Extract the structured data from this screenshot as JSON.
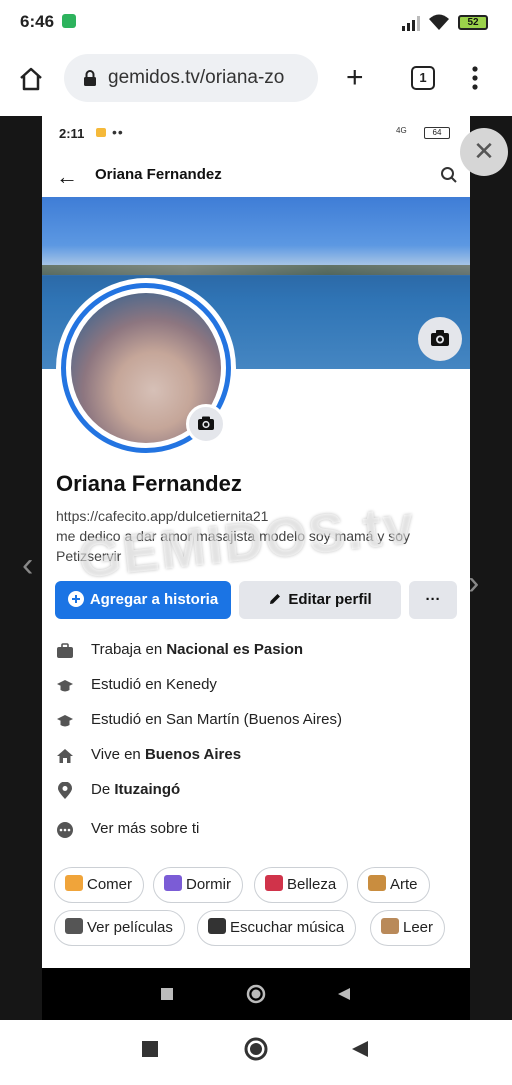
{
  "status_bar": {
    "time": "6:46",
    "battery": "52"
  },
  "browser": {
    "url": "gemidos.tv/oriana-zo",
    "tab_count": "1"
  },
  "viewer": {
    "close_glyph": "✕",
    "prev_glyph": "‹",
    "next_glyph": "›"
  },
  "phone": {
    "status": {
      "time": "2:11",
      "battery": "64",
      "signal": "4G"
    },
    "header": {
      "name": "Oriana Fernandez",
      "back_glyph": "←"
    },
    "profile": {
      "name": "Oriana Fernandez",
      "bio_link": "https://cafecito.app/dulcetiernita21",
      "bio_text": "me dedico a dar amor masajista modelo soy mamá y soy Petizservir",
      "watermark": "GEMIDOS.tv"
    },
    "buttons": {
      "add_story": "Agregar a historia",
      "edit_profile": "Editar perfil",
      "more": "···"
    },
    "details": [
      {
        "prefix": "Trabaja en ",
        "strong": "Nacional es Pasion",
        "icon": "briefcase-icon"
      },
      {
        "prefix": "Estudió en Kenedy",
        "strong": "",
        "icon": "graduation-cap-icon"
      },
      {
        "prefix": "Estudió en San Martín (Buenos Aires)",
        "strong": "",
        "icon": "graduation-cap-icon"
      },
      {
        "prefix": "Vive en ",
        "strong": "Buenos Aires",
        "icon": "home-icon"
      },
      {
        "prefix": "De ",
        "strong": "Ituzaingó",
        "icon": "location-pin-icon"
      },
      {
        "prefix": "Ver más sobre ti",
        "strong": "",
        "icon": "more-dots-icon"
      }
    ],
    "hobbies": [
      {
        "label": "Comer",
        "color": "#f0a43a"
      },
      {
        "label": "Dormir",
        "color": "#7b5cd6"
      },
      {
        "label": "Belleza",
        "color": "#d0334a"
      },
      {
        "label": "Arte",
        "color": "#c98d3f"
      },
      {
        "label": "Ver películas",
        "color": "#555555"
      },
      {
        "label": "Escuchar música",
        "color": "#333333"
      },
      {
        "label": "Leer",
        "color": "#b98a5a"
      }
    ]
  },
  "colors": {
    "accent": "#1b74e4",
    "button_gray": "#e4e6eb"
  }
}
